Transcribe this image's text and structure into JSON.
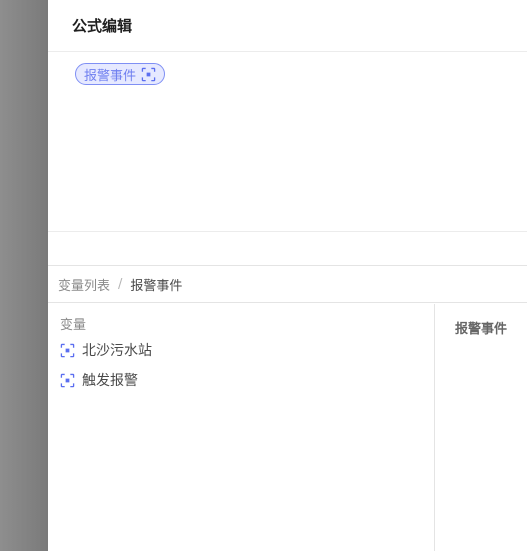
{
  "dialog": {
    "title": "公式编辑"
  },
  "editor": {
    "tag_label": "报警事件",
    "tag_icon": "variable-icon"
  },
  "breadcrumb": {
    "root": "变量列表",
    "separator": "/",
    "current": "报警事件"
  },
  "variables": {
    "group_title": "变量",
    "items": [
      {
        "label": "北沙污水站",
        "icon": "variable-icon"
      },
      {
        "label": "触发报警",
        "icon": "variable-icon"
      }
    ]
  },
  "detail": {
    "title": "报警事件"
  },
  "colors": {
    "accent": "#6f7ff0",
    "tag_bg": "#e6e9ff",
    "icon": "#5b6ef0"
  }
}
